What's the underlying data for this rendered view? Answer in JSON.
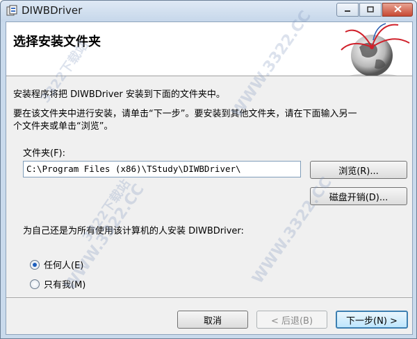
{
  "window": {
    "title": "DIWBDriver",
    "min_label": "▭",
    "max_label": "▢",
    "close_label": "✕"
  },
  "banner": {
    "title": "选择安装文件夹"
  },
  "body": {
    "line1": "安装程序将把 DIWBDriver 安装到下面的文件夹中。",
    "line2": "要在该文件夹中进行安装，请单击“下一步”。要安装到其他文件夹，请在下面输入另一",
    "line3": "个文件夹或单击“浏览”。"
  },
  "folder": {
    "label": "文件夹(F):",
    "path": "C:\\Program Files (x86)\\TStudy\\DIWBDriver\\",
    "browse_label": "浏览(R)...",
    "disk_label": "磁盘开销(D)..."
  },
  "scope": {
    "question": "为自己还是为所有使用该计算机的人安装 DIWBDriver:",
    "options": [
      {
        "label": "任何人(E)",
        "selected": true
      },
      {
        "label": "只有我(M)",
        "selected": false
      }
    ]
  },
  "footer": {
    "cancel_label": "取消",
    "back_label": "< 后退(B)",
    "next_label": "下一步(N) >"
  },
  "watermark": {
    "text1": "WWW.3322.CC",
    "text2": "3322下载站"
  }
}
